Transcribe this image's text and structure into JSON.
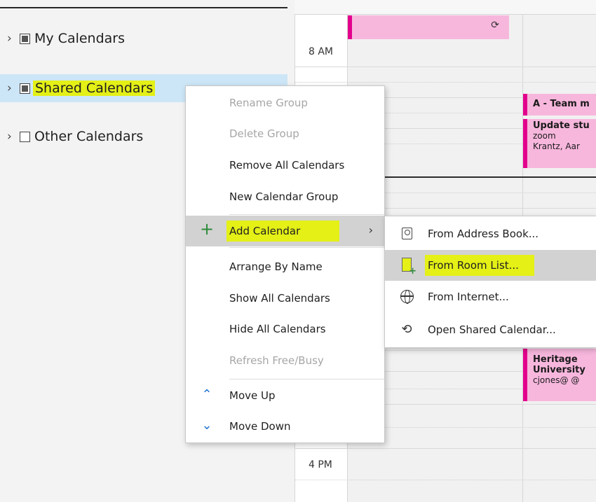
{
  "folder_pane": {
    "groups": [
      {
        "label": "My Calendars",
        "checkbox": "partial"
      },
      {
        "label": "Shared Calendars",
        "checkbox": "partial"
      },
      {
        "label": "Other Calendars",
        "checkbox": "empty"
      }
    ]
  },
  "calendar": {
    "times": [
      "8 AM",
      "4 PM"
    ],
    "events": [
      {
        "title": "A - Team m"
      },
      {
        "title": "Update stu",
        "line2": "zoom",
        "line3": "Krantz, Aar"
      },
      {
        "title": "Heritage",
        "line2": "University",
        "line3": "cjones@ @"
      }
    ],
    "colors": {
      "event_fill": "#f7b7dd",
      "event_accent": "#e3008c"
    }
  },
  "context_menu": {
    "items": [
      {
        "label": "Rename Group",
        "enabled": false
      },
      {
        "label": "Delete Group",
        "enabled": false
      },
      {
        "label": "Remove All Calendars",
        "enabled": true
      },
      {
        "label": "New Calendar Group",
        "enabled": true
      },
      {
        "label": "Add Calendar",
        "enabled": true,
        "icon": "plus-icon",
        "has_submenu": true,
        "highlighted": true
      },
      {
        "label": "Arrange By Name",
        "enabled": true
      },
      {
        "label": "Show All Calendars",
        "enabled": true
      },
      {
        "label": "Hide All Calendars",
        "enabled": true
      },
      {
        "label": "Refresh Free/Busy",
        "enabled": false
      },
      {
        "label": "Move Up",
        "enabled": true,
        "icon": "chevron-up-icon"
      },
      {
        "label": "Move Down",
        "enabled": true,
        "icon": "chevron-down-icon"
      }
    ]
  },
  "submenu": {
    "items": [
      {
        "label": "From Address Book...",
        "icon": "address-book-icon"
      },
      {
        "label": "From Room List...",
        "icon": "room-list-icon",
        "highlighted": true
      },
      {
        "label": "From Internet...",
        "icon": "globe-icon"
      },
      {
        "label": "Open Shared Calendar...",
        "icon": "shared-calendar-icon"
      }
    ]
  },
  "highlight_color": "#e4f016"
}
